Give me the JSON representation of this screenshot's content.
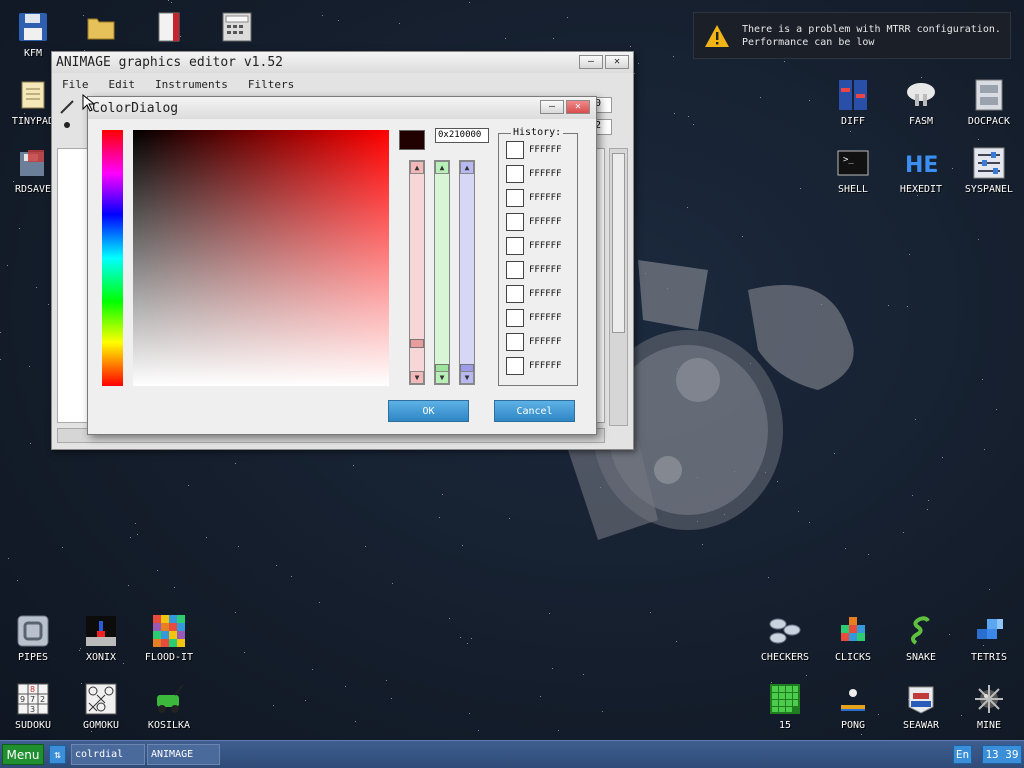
{
  "desktop": {
    "left_icons": [
      {
        "label": "KFM",
        "icon": "floppy-disk-icon"
      },
      {
        "label": "TINYPAD",
        "icon": "notepad-icon"
      },
      {
        "label": "RDSAVE",
        "icon": "save-disk-icon"
      }
    ],
    "top_icons": [
      {
        "label": "",
        "icon": "folder-icon"
      },
      {
        "label": "",
        "icon": "book-icon"
      },
      {
        "label": "",
        "icon": "calculator-icon"
      }
    ],
    "right_icons": [
      {
        "label": "DIFF",
        "icon": "diff-icon"
      },
      {
        "label": "FASM",
        "icon": "fasm-icon"
      },
      {
        "label": "DOCPACK",
        "icon": "docpack-icon"
      },
      {
        "label": "SHELL",
        "icon": "shell-icon"
      },
      {
        "label": "HEXEDIT",
        "icon": "hexedit-icon"
      },
      {
        "label": "SYSPANEL",
        "icon": "syspanel-icon"
      }
    ],
    "bottom_left_icons": [
      {
        "label": "PIPES",
        "icon": "pipes-icon"
      },
      {
        "label": "XONIX",
        "icon": "xonix-icon"
      },
      {
        "label": "FLOOD-IT",
        "icon": "flood-it-icon"
      },
      {
        "label": "SUDOKU",
        "icon": "sudoku-icon"
      },
      {
        "label": "GOMOKU",
        "icon": "gomoku-icon"
      },
      {
        "label": "KOSILKA",
        "icon": "lawnmower-icon"
      }
    ],
    "bottom_right_icons": [
      {
        "label": "CHECKERS",
        "icon": "checkers-icon"
      },
      {
        "label": "CLICKS",
        "icon": "clicks-icon"
      },
      {
        "label": "SNAKE",
        "icon": "snake-icon"
      },
      {
        "label": "TETRIS",
        "icon": "tetris-icon"
      },
      {
        "label": "15",
        "icon": "fifteen-icon"
      },
      {
        "label": "PONG",
        "icon": "pong-icon"
      },
      {
        "label": "SEAWAR",
        "icon": "seawar-icon"
      },
      {
        "label": "MINE",
        "icon": "mine-icon"
      }
    ]
  },
  "notification": {
    "icon": "warning-icon",
    "line1": "There is a problem with MTRR configuration.",
    "line2": "Performance can be low"
  },
  "animage": {
    "title": "ANIMAGE graphics editor v1.52",
    "menu": [
      "File",
      "Edit",
      "Instruments",
      "Filters"
    ],
    "partial_field_1": "0",
    "partial_field_2": "2"
  },
  "color_dialog": {
    "title": "ColorDialog",
    "hex_value": "0x210000",
    "preview_color": "#210000",
    "history_label": "History:",
    "history": [
      "FFFFFF",
      "FFFFFF",
      "FFFFFF",
      "FFFFFF",
      "FFFFFF",
      "FFFFFF",
      "FFFFFF",
      "FFFFFF",
      "FFFFFF",
      "FFFFFF"
    ],
    "ok_label": "OK",
    "cancel_label": "Cancel",
    "red_level": 0.13,
    "green_level": 0,
    "blue_level": 0
  },
  "taskbar": {
    "menu_label": "Menu",
    "arrow_glyph": "⇅",
    "tasks": [
      "colrdial",
      "ANIMAGE"
    ],
    "lang": "En",
    "time": "13 39"
  }
}
